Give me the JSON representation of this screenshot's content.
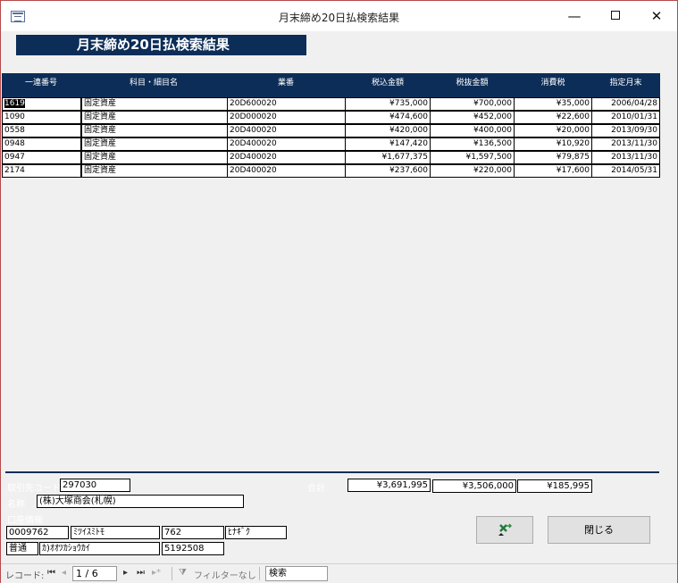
{
  "window": {
    "title": "月末締め20日払検索結果"
  },
  "form": {
    "title": "月末締め20日払検索結果"
  },
  "columns": [
    "一連番号",
    "科目・細目名",
    "業番",
    "税込金額",
    "税抜金額",
    "消費税",
    "指定月末"
  ],
  "rows": [
    {
      "id": "1619",
      "name": "固定資産",
      "code": "20D600020",
      "incl": "¥735,000",
      "excl": "¥700,000",
      "tax": "¥35,000",
      "date": "2006/04/28"
    },
    {
      "id": "1090",
      "name": "固定資産",
      "code": "20D000020",
      "incl": "¥474,600",
      "excl": "¥452,000",
      "tax": "¥22,600",
      "date": "2010/01/31"
    },
    {
      "id": "0558",
      "name": "固定資産",
      "code": "20D400020",
      "incl": "¥420,000",
      "excl": "¥400,000",
      "tax": "¥20,000",
      "date": "2013/09/30"
    },
    {
      "id": "0948",
      "name": "固定資産",
      "code": "20D400020",
      "incl": "¥147,420",
      "excl": "¥136,500",
      "tax": "¥10,920",
      "date": "2013/11/30"
    },
    {
      "id": "0947",
      "name": "固定資産",
      "code": "20D400020",
      "incl": "¥1,677,375",
      "excl": "¥1,597,500",
      "tax": "¥79,875",
      "date": "2013/11/30"
    },
    {
      "id": "2174",
      "name": "固定資産",
      "code": "20D400020",
      "incl": "¥237,600",
      "excl": "¥220,000",
      "tax": "¥17,600",
      "date": "2014/05/31"
    }
  ],
  "footer": {
    "client_code_label": "取引先コード",
    "client_code": "297030",
    "total_label": "合計",
    "total_incl": "¥3,691,995",
    "total_excl": "¥3,506,000",
    "total_tax": "¥185,995",
    "name_label": "名称",
    "name": "(株)大塚商会(札幌)",
    "account_label": "口座情報",
    "bank_code": "0009762",
    "bank_name": "ﾐﾂｲｽﾐﾄﾓ",
    "branch_code": "762",
    "branch_name": "ﾋﾅｷﾞｸ",
    "account_type": "普通",
    "account_holder": "ｶ)ｵｵﾂｶｼｮｳｶｲ",
    "account_no": "5192508",
    "close_button": "閉じる",
    "excel_icon": "excel-export-icon"
  },
  "navigation": {
    "record_label": "レコード:",
    "record_position": "1 / 6",
    "filter_label": "フィルターなし",
    "search_label": "検索"
  }
}
